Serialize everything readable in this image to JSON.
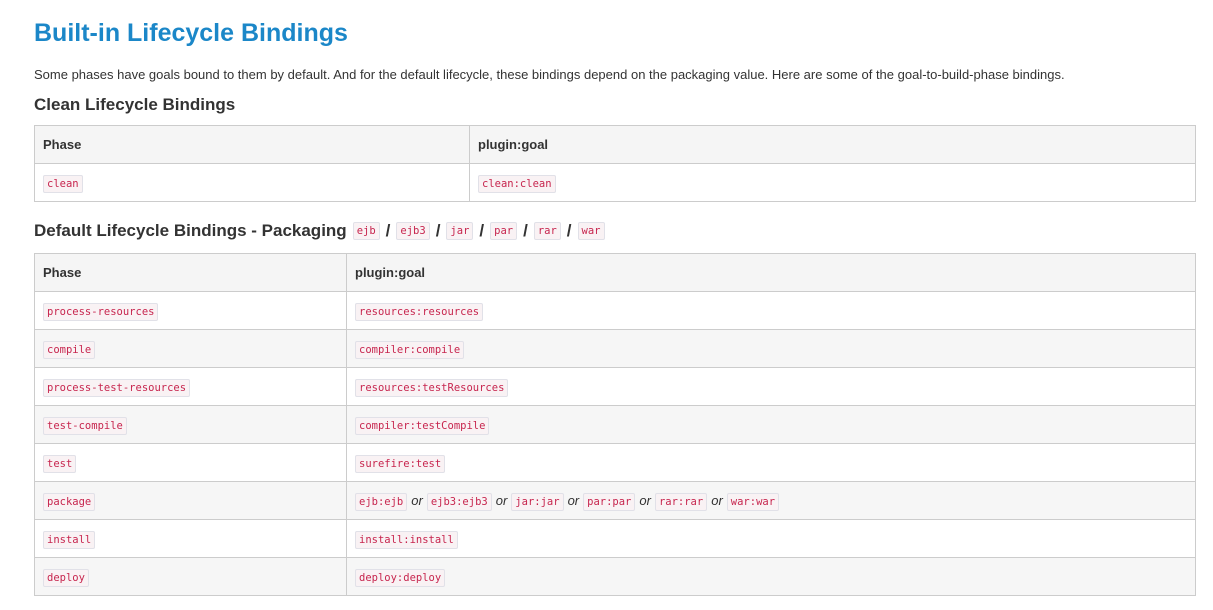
{
  "heading": "Built-in Lifecycle Bindings",
  "intro": "Some phases have goals bound to them by default. And for the default lifecycle, these bindings depend on the packaging value. Here are some of the goal-to-build-phase bindings.",
  "clean_section": {
    "title": "Clean Lifecycle Bindings",
    "columns": [
      "Phase",
      "plugin:goal"
    ],
    "rows": [
      {
        "phase": "clean",
        "goal": "clean:clean"
      }
    ]
  },
  "default_section": {
    "title": "Default Lifecycle Bindings - Packaging",
    "packagings": [
      "ejb",
      "ejb3",
      "jar",
      "par",
      "rar",
      "war"
    ],
    "separator": "/",
    "columns": [
      "Phase",
      "plugin:goal"
    ],
    "or_word": "or",
    "rows": [
      {
        "phase": "process-resources",
        "goals": [
          "resources:resources"
        ]
      },
      {
        "phase": "compile",
        "goals": [
          "compiler:compile"
        ]
      },
      {
        "phase": "process-test-resources",
        "goals": [
          "resources:testResources"
        ]
      },
      {
        "phase": "test-compile",
        "goals": [
          "compiler:testCompile"
        ]
      },
      {
        "phase": "test",
        "goals": [
          "surefire:test"
        ]
      },
      {
        "phase": "package",
        "goals": [
          "ejb:ejb",
          "ejb3:ejb3",
          "jar:jar",
          "par:par",
          "rar:rar",
          "war:war"
        ]
      },
      {
        "phase": "install",
        "goals": [
          "install:install"
        ]
      },
      {
        "phase": "deploy",
        "goals": [
          "deploy:deploy"
        ]
      }
    ]
  }
}
